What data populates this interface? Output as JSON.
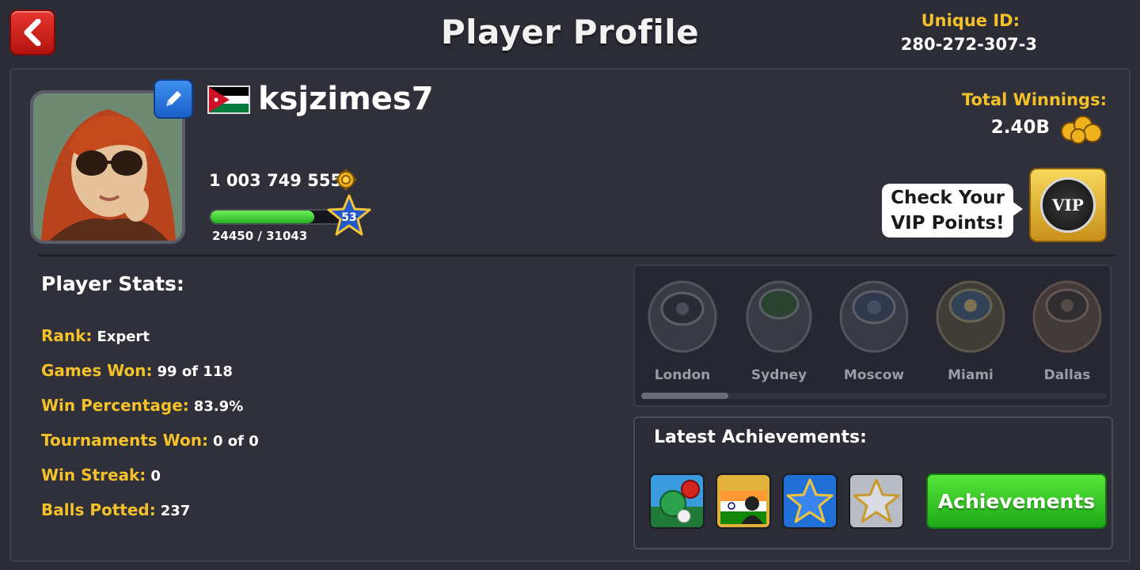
{
  "header": {
    "title": "Player Profile",
    "unique_id_label": "Unique ID:",
    "unique_id_value": "280-272-307-3"
  },
  "profile": {
    "username": "ksjzimes7",
    "coins": "1 003 749 555",
    "level": "53",
    "xp_text": "24450 / 31043",
    "xp_progress": 0.788
  },
  "winnings": {
    "label": "Total Winnings:",
    "value": "2.40B"
  },
  "vip": {
    "bubble_line1": "Check Your",
    "bubble_line2": "VIP Points!",
    "badge_text": "VIP"
  },
  "stats": {
    "title": "Player Stats:",
    "rows": [
      {
        "label": "Rank:",
        "value": "Expert"
      },
      {
        "label": "Games Won:",
        "value": "99 of 118"
      },
      {
        "label": "Win Percentage:",
        "value": "83.9%"
      },
      {
        "label": "Tournaments Won:",
        "value": "0 of 0"
      },
      {
        "label": "Win Streak:",
        "value": "0"
      },
      {
        "label": "Balls Potted:",
        "value": "237"
      }
    ]
  },
  "rings": [
    {
      "name": "London",
      "icon": "london-ring-icon"
    },
    {
      "name": "Sydney",
      "icon": "sydney-ring-icon"
    },
    {
      "name": "Moscow",
      "icon": "moscow-ring-icon"
    },
    {
      "name": "Miami",
      "icon": "miami-ring-icon"
    },
    {
      "name": "Dallas",
      "icon": "dallas-ring-icon"
    }
  ],
  "achievements": {
    "title": "Latest Achievements:",
    "button_label": "Achievements",
    "icons": [
      "pool-balls-achievement-icon",
      "india-flag-achievement-icon",
      "blue-star-achievement-icon",
      "silver-star-achievement-icon"
    ]
  },
  "colors": {
    "background": "#2b2c35",
    "accent_gold": "#f4c12a",
    "button_green": "#2ec222",
    "back_red": "#d3221b",
    "edit_blue": "#2a74dc"
  }
}
